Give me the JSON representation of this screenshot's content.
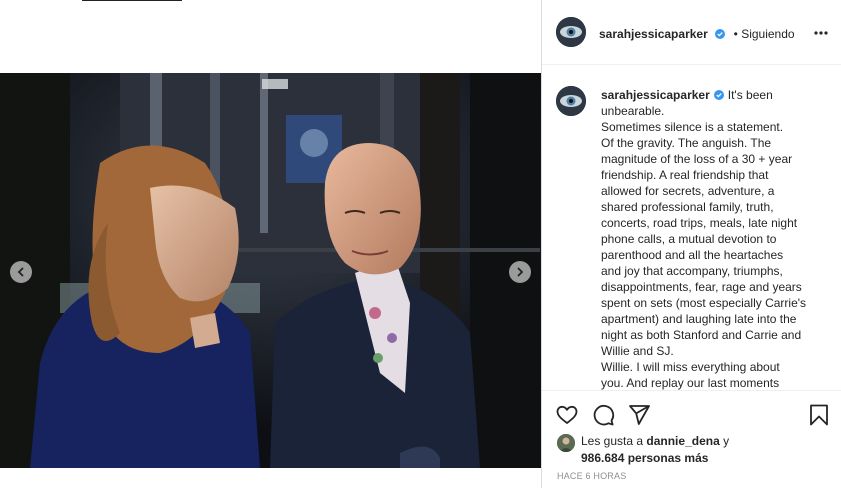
{
  "post": {
    "username": "sarahjessicaparker",
    "follow_status": "• Siguiendo",
    "caption_lines": [
      "It's been",
      "unbearable.",
      "Sometimes silence is a statement.",
      "Of the gravity. The anguish. The",
      "magnitude of the loss of a 30 + year",
      "friendship. A real friendship that",
      "allowed for secrets, adventure, a",
      "shared professional family, truth,",
      "concerts, road trips, meals, late night",
      "phone calls, a mutual devotion to",
      "parenthood and all the heartaches",
      "and joy that accompany, triumphs,",
      "disappointments, fear, rage and years",
      "spent on sets (most especially Carrie's",
      "apartment) and laughing late into the",
      "night as both Stanford and Carrie and",
      "Willie and SJ.",
      "Willie. I will miss everything about",
      "you. And replay our last moments"
    ],
    "likes_prefix": "Les gusta a ",
    "liked_by": "dannie_dena",
    "likes_suffix": " y",
    "likes_count": "986.684 personas más",
    "timestamp": "HACE 6 HORAS"
  },
  "icons": {
    "prev": "chevron-left-icon",
    "next": "chevron-right-icon",
    "like": "heart-icon",
    "comment": "comment-icon",
    "share": "paper-plane-icon",
    "save": "bookmark-icon",
    "more": "more-options-icon",
    "verified": "verified-badge-icon"
  },
  "colors": {
    "verified": "#3897f0",
    "text": "#262626",
    "muted": "#8e8e8e",
    "border": "#dbdbdb"
  }
}
